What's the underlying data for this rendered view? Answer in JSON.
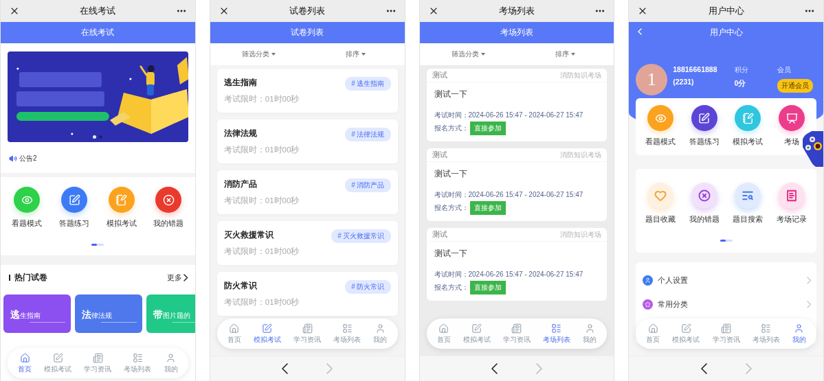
{
  "phones": [
    {
      "kind": "home",
      "nav_title": "在线考试",
      "header_title": "在线考试",
      "banner": {
        "kind": "picture",
        "pages": [
          {
            "selected": true
          },
          {
            "selected": false
          }
        ]
      },
      "notice": "公告2",
      "shortcuts": [
        {
          "kind": "eye",
          "label": "看题模式",
          "color": "#2fd14a"
        },
        {
          "kind": "pen",
          "label": "答题练习",
          "color": "#3d7bf5"
        },
        {
          "kind": "note",
          "label": "模拟考试",
          "color": "#fba21e"
        },
        {
          "kind": "cross",
          "label": "我的错题",
          "color": "#ea3a2e"
        }
      ],
      "section_title": "热门试卷",
      "more_link": "更多",
      "hot_papers": [
        {
          "initial": "逃",
          "rest": "生指南",
          "color": "#8c4ff0"
        },
        {
          "initial": "法",
          "rest": "律法规",
          "color": "#4e78ec"
        },
        {
          "initial": "带",
          "rest": "图片题的",
          "color": "#20c987"
        }
      ],
      "tabbar": [
        {
          "kind": "home",
          "label": "首页",
          "selected": true
        },
        {
          "kind": "exam",
          "label": "模拟考试",
          "selected": false
        },
        {
          "kind": "news",
          "label": "学习资讯",
          "selected": false
        },
        {
          "kind": "list",
          "label": "考场列表",
          "selected": false
        },
        {
          "kind": "user",
          "label": "我的",
          "selected": false
        }
      ]
    },
    {
      "kind": "papers",
      "nav_title": "试卷列表",
      "header_title": "试卷列表",
      "filters": [
        "筛选分类",
        "排序"
      ],
      "papers": [
        {
          "title": "逃生指南",
          "limit": "考试限时：01时00秒",
          "tag": "# 逃生指南"
        },
        {
          "title": "法律法规",
          "limit": "考试限时：01时00秒",
          "tag": "# 法律法规"
        },
        {
          "title": "消防产品",
          "limit": "考试限时：01时00秒",
          "tag": "# 消防产品"
        },
        {
          "title": "灭火救援常识",
          "limit": "考试限时：01时00秒",
          "tag": "# 灭火救援常识"
        },
        {
          "title": "防火常识",
          "limit": "考试限时：01时00秒",
          "tag": "# 防火常识"
        }
      ],
      "tabbar": [
        {
          "kind": "home",
          "label": "首页",
          "selected": false
        },
        {
          "kind": "exam",
          "label": "模拟考试",
          "selected": true
        },
        {
          "kind": "news",
          "label": "学习资讯",
          "selected": false
        },
        {
          "kind": "list",
          "label": "考场列表",
          "selected": false
        },
        {
          "kind": "user",
          "label": "我的",
          "selected": false
        }
      ],
      "browser_bar": {
        "back_enabled": true,
        "forward_enabled": false
      }
    },
    {
      "kind": "venues",
      "nav_title": "考场列表",
      "header_title": "考场列表",
      "filters": [
        "筛选分类",
        "排序"
      ],
      "venues": [
        {
          "category": "测试",
          "venue": "消防知识考场",
          "title": "测试一下",
          "time": "考试时间：2024-06-26 15:47 - 2024-06-27 15:47",
          "signup_label": "报名方式：",
          "signup": "直接参加"
        },
        {
          "category": "测试",
          "venue": "消防知识考场",
          "title": "测试一下",
          "time": "考试时间：2024-06-26 15:47 - 2024-06-27 15:47",
          "signup_label": "报名方式：",
          "signup": "直接参加"
        },
        {
          "category": "测试",
          "venue": "消防知识考场",
          "title": "测试一下",
          "time": "考试时间：2024-06-26 15:47 - 2024-06-27 15:47",
          "signup_label": "报名方式：",
          "signup": "直接参加"
        }
      ],
      "tabbar": [
        {
          "kind": "home",
          "label": "首页",
          "selected": false
        },
        {
          "kind": "exam",
          "label": "模拟考试",
          "selected": false
        },
        {
          "kind": "news",
          "label": "学习资讯",
          "selected": false
        },
        {
          "kind": "list",
          "label": "考场列表",
          "selected": true
        },
        {
          "kind": "user",
          "label": "我的",
          "selected": false
        }
      ],
      "browser_bar": {
        "back_enabled": true,
        "forward_enabled": false
      }
    },
    {
      "kind": "profile",
      "nav_title": "用户中心",
      "header_title": "用户中心",
      "user": {
        "avatar": "1",
        "phone": "18816661888",
        "id": "(2231)",
        "points_label": "积分",
        "points": "0分",
        "member_label": "会员",
        "member_button": "开通会员"
      },
      "tools": [
        {
          "kind": "eye",
          "label": "看题模式",
          "color": "#fba21e"
        },
        {
          "kind": "pen",
          "label": "答题练习",
          "color": "#5b45d6"
        },
        {
          "kind": "note",
          "label": "模拟考试",
          "color": "#2fc6e0"
        },
        {
          "kind": "chart",
          "label": "考场",
          "color": "#ec3d8c"
        }
      ],
      "more_tools": [
        {
          "kind": "heart",
          "label": "题目收藏",
          "color": "#f6a43a"
        },
        {
          "kind": "cross",
          "label": "我的错题",
          "color": "#9b3fe0"
        },
        {
          "kind": "search",
          "label": "题目搜索",
          "color": "#3f7af0"
        },
        {
          "kind": "receipt",
          "label": "考场记录",
          "color": "#e8338a"
        }
      ],
      "menu": [
        {
          "kind": "user",
          "label": "个人设置",
          "color": "#3b7cf0"
        },
        {
          "kind": "star",
          "label": "常用分类",
          "color": "#b45ae8"
        }
      ],
      "tabbar": [
        {
          "kind": "home",
          "label": "首页",
          "selected": false
        },
        {
          "kind": "exam",
          "label": "模拟考试",
          "selected": false
        },
        {
          "kind": "news",
          "label": "学习资讯",
          "selected": false
        },
        {
          "kind": "list",
          "label": "考场列表",
          "selected": false
        },
        {
          "kind": "user",
          "label": "我的",
          "selected": true
        }
      ],
      "browser_bar": {
        "back_enabled": true,
        "forward_enabled": false
      }
    }
  ]
}
